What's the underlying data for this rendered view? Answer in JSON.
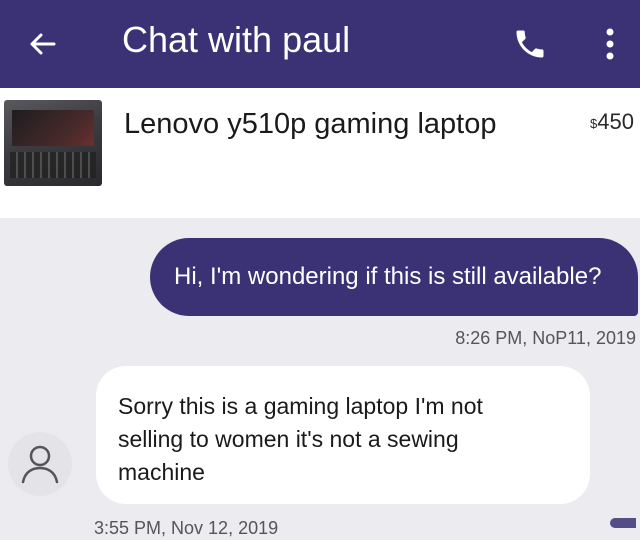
{
  "header": {
    "title": "Chat with paul",
    "back_icon": "arrow-left-icon",
    "call_icon": "phone-icon",
    "more_icon": "more-vertical-icon",
    "background": "#3a3274"
  },
  "listing": {
    "title": "Lenovo y510p gaming laptop",
    "price_symbol": "$",
    "price": "450",
    "thumbnail": "laptop-image"
  },
  "messages": [
    {
      "direction": "outgoing",
      "text": "Hi, I'm wondering if this is still available?",
      "timestamp": "8:26 PM, NoP11, 2019"
    },
    {
      "direction": "incoming",
      "lines": [
        "Sorry this is a gaming laptop I'm not",
        "selling to women it's not a sewing",
        "machine"
      ],
      "timestamp": "3:55 PM, Nov 12, 2019",
      "avatar_icon": "user-avatar-icon"
    }
  ],
  "colors": {
    "accent": "#3a3274",
    "chat_background": "#ebebf0",
    "incoming_bubble": "#ffffff"
  }
}
